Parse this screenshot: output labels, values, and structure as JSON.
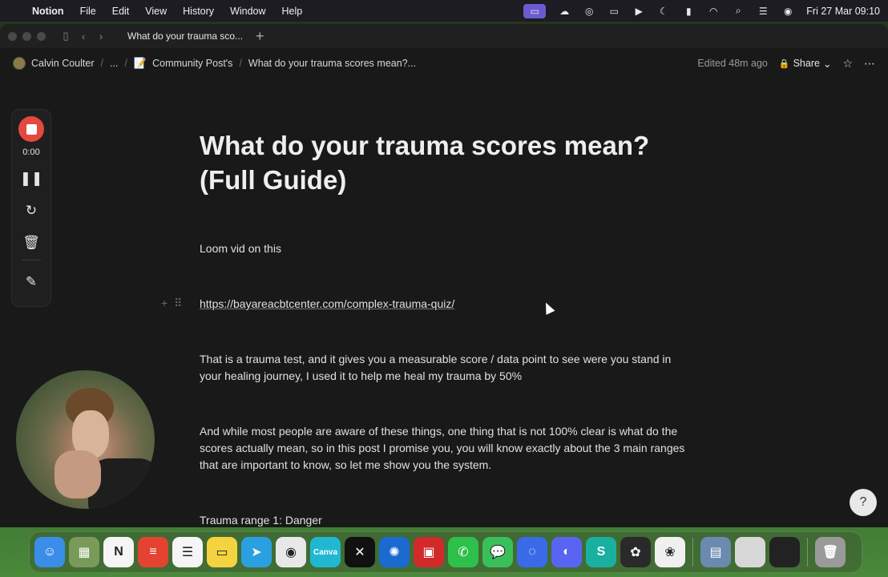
{
  "menubar": {
    "app": "Notion",
    "menus": [
      "File",
      "Edit",
      "View",
      "History",
      "Window",
      "Help"
    ],
    "clock": "Fri 27 Mar  09:10",
    "tray": [
      "screen-record-icon",
      "cloud-icon",
      "vpn-icon",
      "display-icon",
      "play-icon",
      "moon-icon",
      "battery-icon",
      "wifi-icon",
      "search-icon",
      "control-center-icon",
      "siri-icon"
    ]
  },
  "window": {
    "tab_title": "What do your trauma sco...",
    "breadcrumb": {
      "user": "Calvin Coulter",
      "ellipsis": "...",
      "parent": "Community Post's",
      "current": "What do your trauma scores mean?..."
    },
    "edited": "Edited 48m ago",
    "share_label": "Share"
  },
  "loom": {
    "time": "0:00"
  },
  "document": {
    "title": "What do your trauma scores mean? (Full Guide)",
    "loom_line": "Loom vid on this",
    "link": "https://bayareacbtcenter.com/complex-trauma-quiz/",
    "para1": "That is a trauma test, and it gives you a measurable score / data point to see were you stand in your healing journey, I used it to help me heal my trauma by 50%",
    "para2": "And while most people are aware of these things, one thing that is not 100% clear is what do the scores actually mean, so in this post I promise you, you will know exactly about the 3 main ranges that are important to know, so let me show you the system.",
    "para3": "Trauma range 1: Danger"
  },
  "dock": {
    "apps": [
      {
        "name": "finder",
        "color": "#3a8ee8",
        "glyph": "☺"
      },
      {
        "name": "launchpad",
        "color": "#7a9a5a",
        "glyph": "▦"
      },
      {
        "name": "notion",
        "color": "#f5f5f5",
        "glyph": "N"
      },
      {
        "name": "todoist",
        "color": "#e44332",
        "glyph": "≡"
      },
      {
        "name": "reminders",
        "color": "#f5f5f5",
        "glyph": "☰"
      },
      {
        "name": "notes",
        "color": "#f5d340",
        "glyph": "▭"
      },
      {
        "name": "telegram",
        "color": "#2aa0e0",
        "glyph": "➤"
      },
      {
        "name": "chrome",
        "color": "#e8e8e8",
        "glyph": "◉"
      },
      {
        "name": "canva",
        "color": "#20b8d0",
        "glyph": "Canva"
      },
      {
        "name": "capcut",
        "color": "#111111",
        "glyph": "✕"
      },
      {
        "name": "perplexity",
        "color": "#1a6ad0",
        "glyph": "✺"
      },
      {
        "name": "photo-booth",
        "color": "#d02a2a",
        "glyph": "▣"
      },
      {
        "name": "whatsapp",
        "color": "#2ec04a",
        "glyph": "✆"
      },
      {
        "name": "messages",
        "color": "#3ac05a",
        "glyph": "💬"
      },
      {
        "name": "signal",
        "color": "#3a6ae8",
        "glyph": "◌"
      },
      {
        "name": "discord",
        "color": "#5865f2",
        "glyph": "◐"
      },
      {
        "name": "surfshark",
        "color": "#1ab0a0",
        "glyph": "S"
      },
      {
        "name": "chatgpt",
        "color": "#2a2a2a",
        "glyph": "✿"
      },
      {
        "name": "photos",
        "color": "#f0f0f0",
        "glyph": "❀"
      },
      {
        "name": "preview",
        "color": "#6a8ab0",
        "glyph": "▤"
      },
      {
        "name": "recent-window-1",
        "color": "#d8d8d8",
        "glyph": ""
      },
      {
        "name": "recent-window-2",
        "color": "#222222",
        "glyph": ""
      },
      {
        "name": "trash",
        "color": "#9a9a9a",
        "glyph": "🗑"
      }
    ]
  }
}
